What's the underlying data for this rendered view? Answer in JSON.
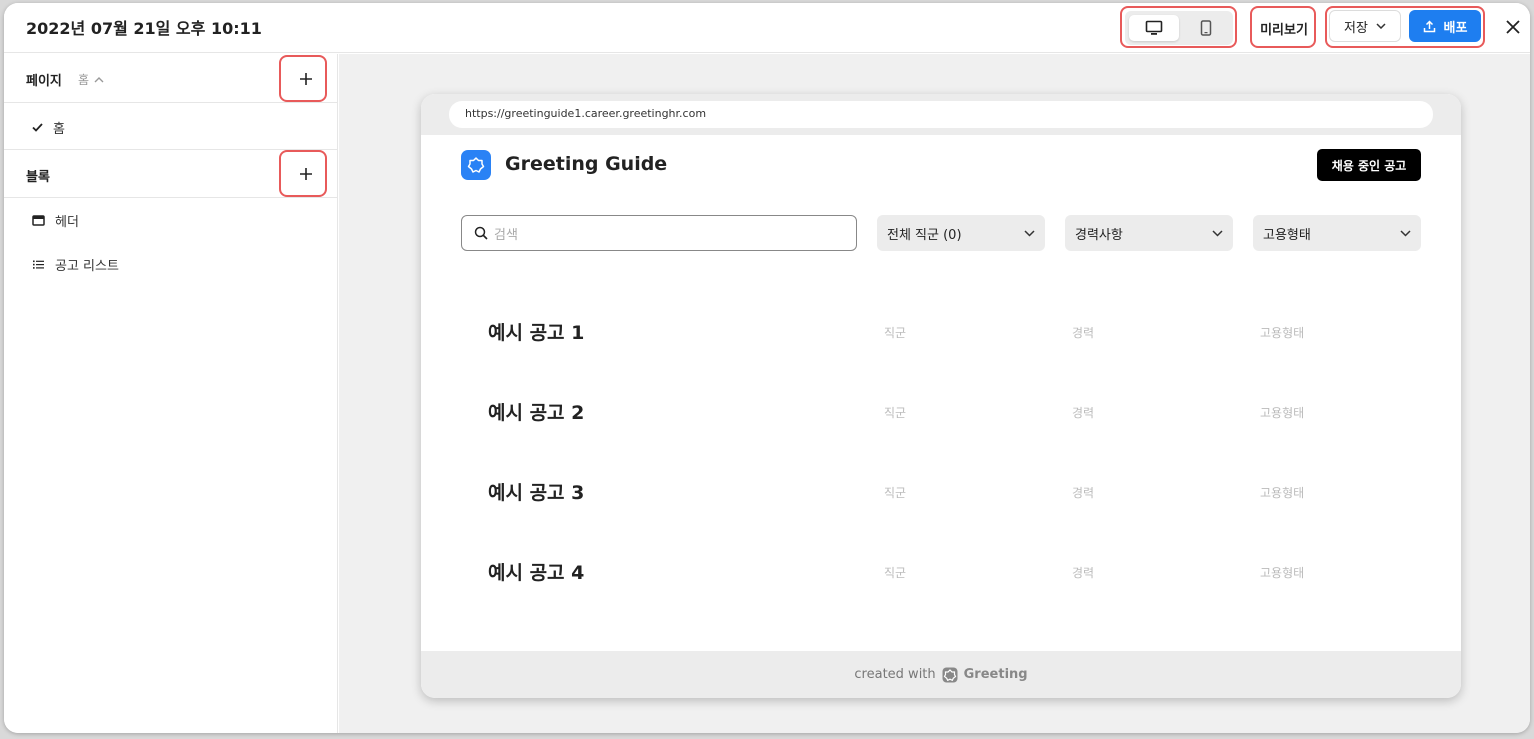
{
  "topbar": {
    "title": "2022년 07월 21일 오후 10:11",
    "preview_label": "미리보기",
    "save_label": "저장",
    "deploy_label": "배포"
  },
  "sidebar": {
    "pages_label": "페이지",
    "pages_current": "홈",
    "pages_items": [
      {
        "label": "홈"
      }
    ],
    "blocks_label": "블록",
    "blocks_items": [
      {
        "label": "헤더"
      },
      {
        "label": "공고 리스트"
      }
    ]
  },
  "preview": {
    "url": "https://greetinguide1.career.greetinghr.com",
    "brand": "Greeting Guide",
    "jobs_button": "채용 중인 공고",
    "search_placeholder": "검색",
    "filters": [
      "전체 직군 (0)",
      "경력사항",
      "고용형태"
    ],
    "jobs": [
      {
        "title": "예시 공고 1",
        "category": "직군",
        "career": "경력",
        "type": "고용형태"
      },
      {
        "title": "예시 공고 2",
        "category": "직군",
        "career": "경력",
        "type": "고용형태"
      },
      {
        "title": "예시 공고 3",
        "category": "직군",
        "career": "경력",
        "type": "고용형태"
      },
      {
        "title": "예시 공고 4",
        "category": "직군",
        "career": "경력",
        "type": "고용형태"
      }
    ],
    "footer_text": "created with",
    "footer_brand": "Greeting"
  },
  "colors": {
    "accent": "#1e7ef0",
    "highlight": "#e85a5a",
    "logo": "#2a82f5"
  },
  "icons": [
    "desktop-icon",
    "mobile-icon",
    "chevron-down-icon",
    "upload-icon",
    "close-icon",
    "chevron-up-icon",
    "plus-icon",
    "check-icon",
    "header-block-icon",
    "list-icon",
    "search-icon",
    "greeting-logo-icon"
  ]
}
